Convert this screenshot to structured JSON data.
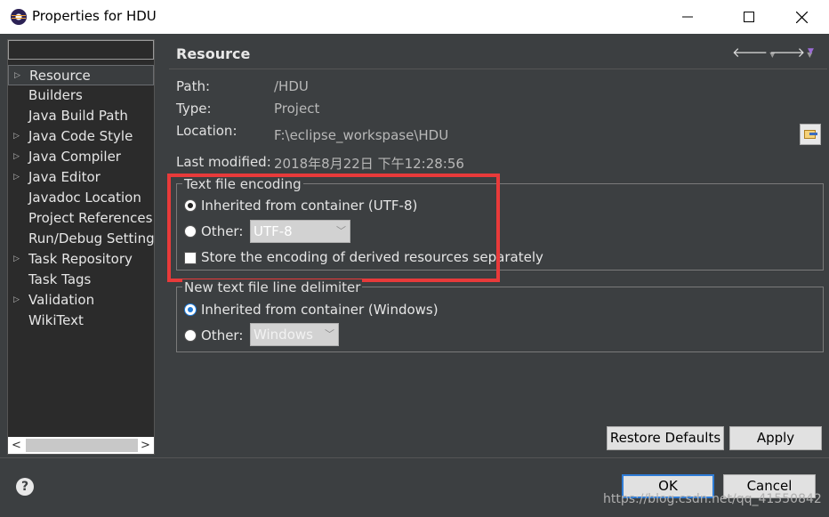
{
  "window": {
    "title": "Properties for HDU"
  },
  "filter": {
    "value": ""
  },
  "tree": {
    "items": [
      {
        "label": "Resource",
        "expandable": true,
        "selected": true
      },
      {
        "label": "Builders",
        "expandable": false
      },
      {
        "label": "Java Build Path",
        "expandable": false
      },
      {
        "label": "Java Code Style",
        "expandable": true
      },
      {
        "label": "Java Compiler",
        "expandable": true
      },
      {
        "label": "Java Editor",
        "expandable": true
      },
      {
        "label": "Javadoc Location",
        "expandable": false
      },
      {
        "label": "Project References",
        "expandable": false
      },
      {
        "label": "Run/Debug Settings",
        "expandable": false
      },
      {
        "label": "Task Repository",
        "expandable": true
      },
      {
        "label": "Task Tags",
        "expandable": false
      },
      {
        "label": "Validation",
        "expandable": true
      },
      {
        "label": "WikiText",
        "expandable": false
      }
    ]
  },
  "page": {
    "title": "Resource",
    "path_label": "Path:",
    "path_value": "/HDU",
    "type_label": "Type:",
    "type_value": "Project",
    "location_label": "Location:",
    "location_value": "F:\\eclipse_workspase\\HDU",
    "modified_label": "Last modified:",
    "modified_value": "2018年8月22日 下午12:28:56"
  },
  "encoding": {
    "legend": "Text file encoding",
    "inherited_label": "Inherited from container (UTF-8)",
    "other_label": "Other:",
    "other_value": "UTF-8",
    "store_label": "Store the encoding of derived resources separately"
  },
  "delimiter": {
    "legend": "New text file line delimiter",
    "inherited_label": "Inherited from container (Windows)",
    "other_label": "Other:",
    "other_value": "Windows"
  },
  "buttons": {
    "restore": "Restore Defaults",
    "apply": "Apply",
    "ok": "OK",
    "cancel": "Cancel"
  },
  "watermark": "https://blog.csdn.net/qq_41550842",
  "colors": {
    "highlight_box": "#e83a3a",
    "accent": "#2f7cd6"
  }
}
